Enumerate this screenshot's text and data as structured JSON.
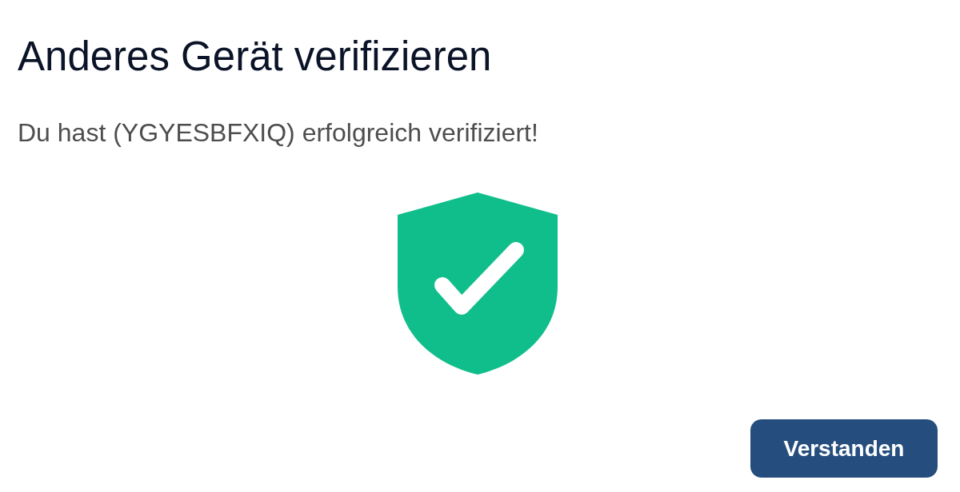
{
  "dialog": {
    "title": "Anderes Gerät verifizieren",
    "message": "Du hast (YGYESBFXIQ) erfolgreich verifiziert!",
    "button": {
      "label": "Verstanden"
    }
  }
}
